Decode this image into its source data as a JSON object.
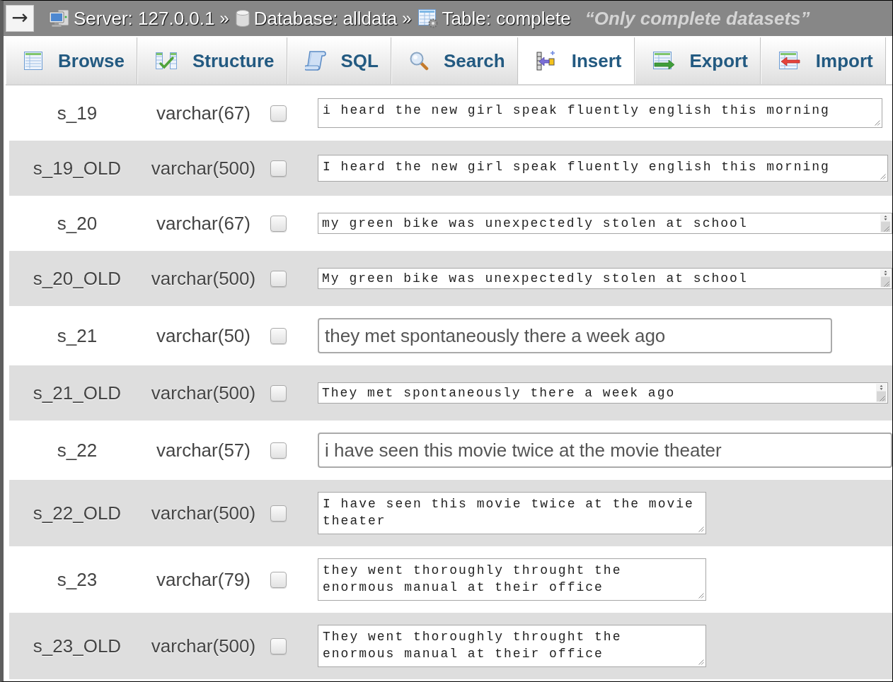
{
  "topbar": {
    "toggle": "→",
    "breadcrumb": [
      {
        "label": "Server: 127.0.0.1",
        "separator": "»"
      },
      {
        "label": "Database: alldata",
        "separator": "»"
      },
      {
        "label": "Table: complete"
      }
    ],
    "comment": "“Only complete datasets”"
  },
  "tabs": [
    {
      "label": "Browse",
      "selected": false
    },
    {
      "label": "Structure",
      "selected": false
    },
    {
      "label": "SQL",
      "selected": false
    },
    {
      "label": "Search",
      "selected": false
    },
    {
      "label": "Insert",
      "selected": true
    },
    {
      "label": "Export",
      "selected": false
    },
    {
      "label": "Import",
      "selected": false
    }
  ],
  "rows": [
    {
      "name": "s_19",
      "type": "varchar(67)",
      "checked": false,
      "kind": "textarea",
      "value": "i heard the new girl speak fluently english this morning"
    },
    {
      "name": "s_19_OLD",
      "type": "varchar(500)",
      "checked": false,
      "kind": "textarea",
      "value": "I heard the new girl speak fluently english this morning"
    },
    {
      "name": "s_20",
      "type": "varchar(67)",
      "checked": false,
      "kind": "textarea_scroll",
      "value": "my green bike was unexpectedly stolen at school"
    },
    {
      "name": "s_20_OLD",
      "type": "varchar(500)",
      "checked": false,
      "kind": "textarea_scroll",
      "value": "My green bike was unexpectedly stolen at school"
    },
    {
      "name": "s_21",
      "type": "varchar(50)",
      "checked": false,
      "kind": "input",
      "value": "they met spontaneously there a week ago"
    },
    {
      "name": "s_21_OLD",
      "type": "varchar(500)",
      "checked": false,
      "kind": "textarea_scroll",
      "value": "They met spontaneously there a week ago"
    },
    {
      "name": "s_22",
      "type": "varchar(57)",
      "checked": false,
      "kind": "input",
      "value": "i have seen this movie twice at the movie theater"
    },
    {
      "name": "s_22_OLD",
      "type": "varchar(500)",
      "checked": false,
      "kind": "textarea",
      "value": "I have seen this movie twice at the movie theater"
    },
    {
      "name": "s_23",
      "type": "varchar(79)",
      "checked": false,
      "kind": "textarea",
      "value": "they went thoroughly throught the enormous manual at their office"
    },
    {
      "name": "s_23_OLD",
      "type": "varchar(500)",
      "checked": false,
      "kind": "textarea",
      "value": "They went thoroughly throught the enormous manual at their office"
    }
  ]
}
